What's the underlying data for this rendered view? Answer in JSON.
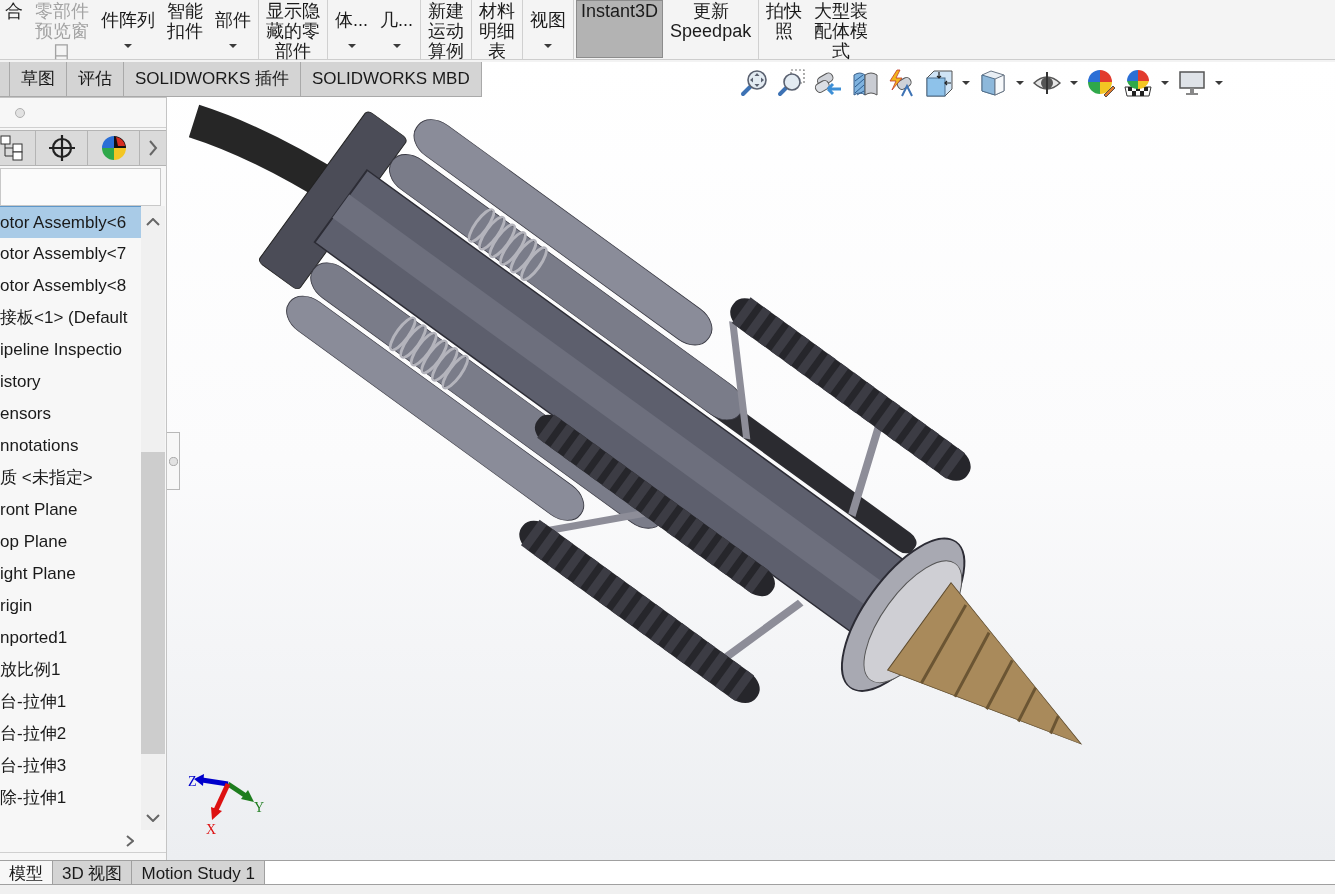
{
  "toolbar": {
    "groups": [
      {
        "buttons": [
          {
            "kind": "stacked",
            "lines": [
              "合"
            ],
            "disabled": false,
            "pressed": false
          },
          {
            "kind": "stacked",
            "lines": [
              "零部件",
              "预览窗",
              "口"
            ],
            "disabled": true,
            "pressed": false
          },
          {
            "kind": "dropdown",
            "lines": [
              "件阵列"
            ],
            "disabled": false,
            "pressed": false
          },
          {
            "kind": "stacked",
            "lines": [
              "智能",
              "扣件"
            ],
            "disabled": false,
            "pressed": false
          },
          {
            "kind": "dropdown",
            "lines": [
              "部件"
            ],
            "disabled": false,
            "pressed": false
          }
        ]
      },
      {
        "buttons": [
          {
            "kind": "stacked",
            "lines": [
              "显示隐",
              "藏的零",
              "部件"
            ],
            "disabled": false,
            "pressed": false
          }
        ]
      },
      {
        "buttons": [
          {
            "kind": "dropdown",
            "lines": [
              "体..."
            ],
            "disabled": false,
            "pressed": false
          },
          {
            "kind": "dropdown",
            "lines": [
              "几..."
            ],
            "disabled": false,
            "pressed": false
          }
        ]
      },
      {
        "buttons": [
          {
            "kind": "stacked",
            "lines": [
              "新建",
              "运动",
              "算例"
            ],
            "disabled": false,
            "pressed": false
          }
        ]
      },
      {
        "buttons": [
          {
            "kind": "stacked",
            "lines": [
              "材料",
              "明细",
              "表"
            ],
            "disabled": false,
            "pressed": false
          }
        ]
      },
      {
        "buttons": [
          {
            "kind": "dropdown",
            "lines": [
              "视图"
            ],
            "disabled": false,
            "pressed": false
          }
        ]
      },
      {
        "buttons": [
          {
            "kind": "stacked",
            "lines": [
              "Instant3D"
            ],
            "disabled": false,
            "pressed": true
          },
          {
            "kind": "stacked",
            "lines": [
              "更新",
              "Speedpak"
            ],
            "disabled": false,
            "pressed": false
          }
        ]
      },
      {
        "buttons": [
          {
            "kind": "stacked",
            "lines": [
              "拍快",
              "照"
            ],
            "disabled": false,
            "pressed": false
          },
          {
            "kind": "stacked",
            "lines": [
              "大型装",
              "配体模",
              "式"
            ],
            "disabled": false,
            "pressed": false
          }
        ]
      }
    ]
  },
  "command_tabs": [
    {
      "label": "草图",
      "selected": false
    },
    {
      "label": "评估",
      "selected": false
    },
    {
      "label": "SOLIDWORKS 插件",
      "selected": false
    },
    {
      "label": "SOLIDWORKS MBD",
      "selected": false
    }
  ],
  "feature_tree": {
    "items": [
      {
        "label": "otor Assembly<6",
        "selected": true
      },
      {
        "label": "otor Assembly<7",
        "selected": false
      },
      {
        "label": "otor Assembly<8",
        "selected": false
      },
      {
        "label": "接板<1> (Default",
        "selected": false
      },
      {
        "label": "ipeline Inspectio",
        "selected": false
      },
      {
        "label": "istory",
        "selected": false
      },
      {
        "label": "ensors",
        "selected": false
      },
      {
        "label": "nnotations",
        "selected": false
      },
      {
        "label": "质 <未指定>",
        "selected": false
      },
      {
        "label": "ront Plane",
        "selected": false
      },
      {
        "label": "op Plane",
        "selected": false
      },
      {
        "label": "ight Plane",
        "selected": false
      },
      {
        "label": "rigin",
        "selected": false
      },
      {
        "label": "nported1",
        "selected": false
      },
      {
        "label": "放比例1",
        "selected": false
      },
      {
        "label": "台-拉伸1",
        "selected": false
      },
      {
        "label": "台-拉伸2",
        "selected": false
      },
      {
        "label": "台-拉伸3",
        "selected": false
      },
      {
        "label": "除-拉伸1",
        "selected": false
      }
    ]
  },
  "triad": [
    {
      "label": "Z",
      "color": "#0000cc"
    },
    {
      "label": "Y",
      "color": "#1e7d1e"
    },
    {
      "label": "X",
      "color": "#dd1111"
    }
  ],
  "bottom_tabs": [
    {
      "label": "模型",
      "selected": true
    },
    {
      "label": "3D 视图",
      "selected": false
    },
    {
      "label": "Motion Study 1",
      "selected": false
    }
  ]
}
